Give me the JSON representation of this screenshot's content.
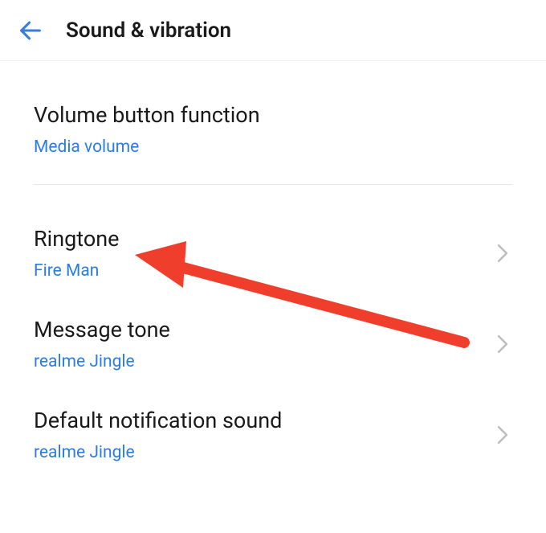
{
  "header": {
    "title": "Sound & vibration"
  },
  "settings": [
    {
      "title": "Volume button function",
      "value": "Media volume",
      "has_chevron": false
    },
    {
      "title": "Ringtone",
      "value": "Fire Man",
      "has_chevron": true
    },
    {
      "title": "Message tone",
      "value": "realme Jingle",
      "has_chevron": true
    },
    {
      "title": "Default notification sound",
      "value": "realme Jingle",
      "has_chevron": true
    }
  ],
  "colors": {
    "accent": "#2b7de0",
    "annotation": "#F03E2D"
  }
}
